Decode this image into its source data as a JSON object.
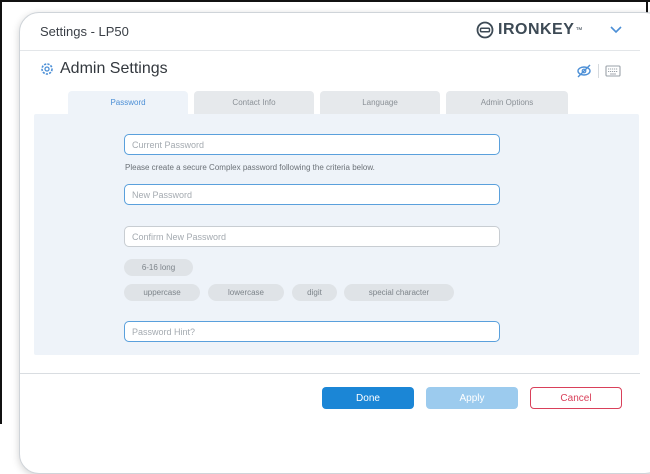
{
  "window": {
    "title": "Settings - LP50"
  },
  "brand": {
    "name": "IRONKEY",
    "trademark": "™"
  },
  "header": {
    "title": "Admin Settings"
  },
  "tabs": [
    {
      "label": "Password",
      "active": true
    },
    {
      "label": "Contact Info",
      "active": false
    },
    {
      "label": "Language",
      "active": false
    },
    {
      "label": "Admin Options",
      "active": false
    }
  ],
  "form": {
    "current_password": {
      "placeholder": "Current Password",
      "value": ""
    },
    "helper_text": "Please create a secure Complex password following the criteria below.",
    "new_password": {
      "placeholder": "New Password",
      "value": ""
    },
    "confirm_password": {
      "placeholder": "Confirm New Password",
      "value": ""
    },
    "criteria": {
      "length": "6-16 long",
      "uppercase": "uppercase",
      "lowercase": "lowercase",
      "digit": "digit",
      "special": "special character"
    },
    "hint": {
      "placeholder": "Password Hint?",
      "value": ""
    }
  },
  "buttons": {
    "done": "Done",
    "apply": "Apply",
    "cancel": "Cancel"
  },
  "colors": {
    "accent": "#1b86d6",
    "accent_disabled": "#9ccbee",
    "cancel": "#d9405a",
    "panel": "#eef3f9"
  },
  "icons": {
    "admin": "gear-icon",
    "brand": "ironkey-logo-icon",
    "menu": "chevron-down-icon",
    "visibility": "eye-off-icon",
    "keyboard": "keyboard-icon"
  }
}
